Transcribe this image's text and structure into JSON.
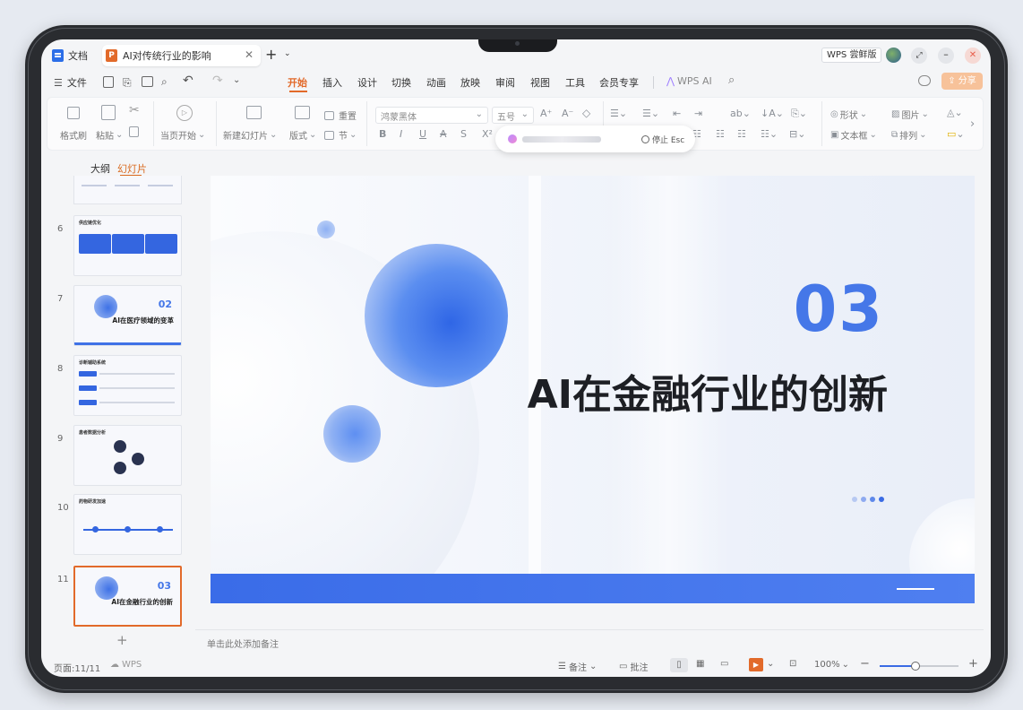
{
  "tabs": {
    "doc": "文档",
    "ppt": "AI对传统行业的影响"
  },
  "titlebar": {
    "wps_badge": "WPS 尝鲜版"
  },
  "menubar": {
    "file": "文件",
    "items": [
      "开始",
      "插入",
      "设计",
      "切换",
      "动画",
      "放映",
      "审阅",
      "视图",
      "工具",
      "会员专享"
    ],
    "active": "开始",
    "wps_ai": "WPS AI"
  },
  "ribbon": {
    "format_painter": "格式刷",
    "paste": "粘贴",
    "from_start": "当页开始",
    "new_slide": "新建幻灯片",
    "layout": "版式",
    "reset": "重置",
    "section": "节",
    "font": "鸿蒙黑体",
    "font_size": "五号",
    "shape": "形状",
    "picture": "图片",
    "textbox": "文本框",
    "arrange": "排列"
  },
  "popup": {
    "stop": "停止 Esc"
  },
  "panel": {
    "outline_tab": "大纲",
    "slides_tab": "幻灯片",
    "slides": [
      {
        "num": "6",
        "title": "供应链优化"
      },
      {
        "num": "7",
        "badge": "02",
        "title": "AI在医疗领域的变革"
      },
      {
        "num": "8",
        "title": "诊断辅助系统"
      },
      {
        "num": "9",
        "title": "患者数据分析"
      },
      {
        "num": "10",
        "title": "药物研发加速"
      },
      {
        "num": "11",
        "badge": "03",
        "title": "AI在金融行业的创新"
      }
    ],
    "add": "+"
  },
  "slide": {
    "number": "03",
    "title": "AI在金融行业的创新"
  },
  "notes": {
    "placeholder": "单击此处添加备注"
  },
  "status": {
    "page": "页面:11/11",
    "wps": "WPS",
    "notes": "备注",
    "comments": "批注",
    "zoom": "100%",
    "zoom_level": 0.46
  },
  "colors": {
    "accent": "#e26a2a",
    "slide_blue": "#3f72e6",
    "close_red": "#e85d4a"
  }
}
